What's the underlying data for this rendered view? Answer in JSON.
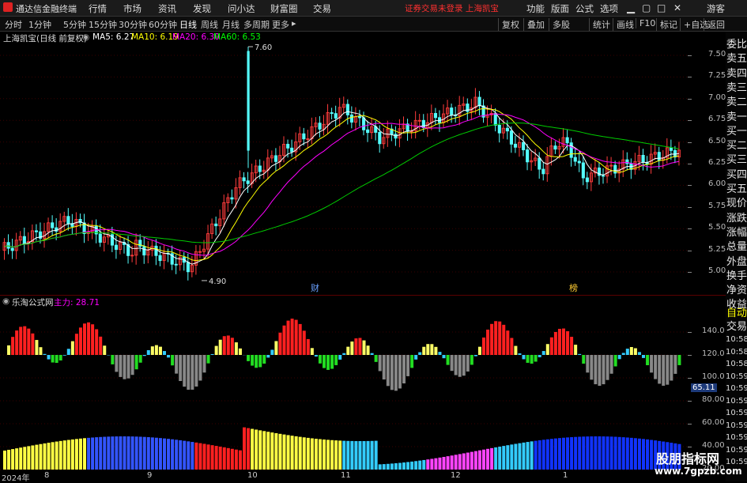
{
  "app": {
    "title": "通达信金融终端"
  },
  "menu": [
    "行情",
    "市场",
    "资讯",
    "发现",
    "问小达",
    "财富圈",
    "交易"
  ],
  "notice": "证券交易未登录  上海凯宝",
  "top_right": [
    "功能",
    "版面",
    "公式",
    "选项"
  ],
  "guest": "游客",
  "periods": [
    "分时",
    "1分钟",
    "5分钟",
    "15分钟",
    "30分钟",
    "60分钟",
    "日线",
    "周线",
    "月线",
    "多周期",
    "更多"
  ],
  "active_period": "日线",
  "tools": [
    "复权",
    "叠加",
    "多股",
    "统计",
    "画线",
    "F10",
    "标记",
    "+自选",
    "返回"
  ],
  "header": {
    "name": "上海凯宝(日线 前复权)"
  },
  "ma": [
    {
      "label": "MA5: 6.27",
      "color": "#ffffff"
    },
    {
      "label": "MA10: 6.19",
      "color": "#ffff00"
    },
    {
      "label": "MA20: 6.30",
      "color": "#ff00ff"
    },
    {
      "label": "MA60: 6.53",
      "color": "#00ff00"
    }
  ],
  "price_axis": [
    "7.50",
    "7.25",
    "7.00",
    "6.75",
    "6.50",
    "6.25",
    "6.00",
    "5.75",
    "5.50",
    "5.25",
    "5.00"
  ],
  "annotations": {
    "high": "7.60",
    "low": "4.90",
    "marker1": "财",
    "marker2": "榜"
  },
  "indicator": {
    "name": "乐淘公式网",
    "value_label": "主力: 28.71"
  },
  "ind_axis": [
    "140.0",
    "120.0",
    "100.0",
    "80.00",
    "60.00",
    "40.00",
    "20.00"
  ],
  "ind_current": "65.11",
  "right_panel": [
    "委比",
    "卖五",
    "卖四",
    "卖三",
    "卖二",
    "卖一",
    "买一",
    "买二",
    "买三",
    "买四",
    "买五",
    "现价",
    "涨跌",
    "涨幅",
    "总量",
    "外盘",
    "换手",
    "净资",
    "收益"
  ],
  "right_panel2": [
    "自动",
    "交易"
  ],
  "time_labels": [
    "10:58",
    "10:58",
    "10:58",
    "10:59",
    "10:59",
    "10:59",
    "10:59",
    "10:59",
    "10:59",
    "10:59",
    "10:59"
  ],
  "x_axis": [
    "2024年",
    "8",
    "9",
    "10",
    "11",
    "12",
    "1"
  ],
  "watermark": {
    "line1": "股朋指标网",
    "line2": "www.7gpzb.com"
  },
  "colors": {
    "up": "#ff3c3c",
    "down": "#54ffff",
    "ma5": "#ffffff",
    "ma10": "#ffff00",
    "ma20": "#ff00ff",
    "ma60": "#00cc00"
  }
}
